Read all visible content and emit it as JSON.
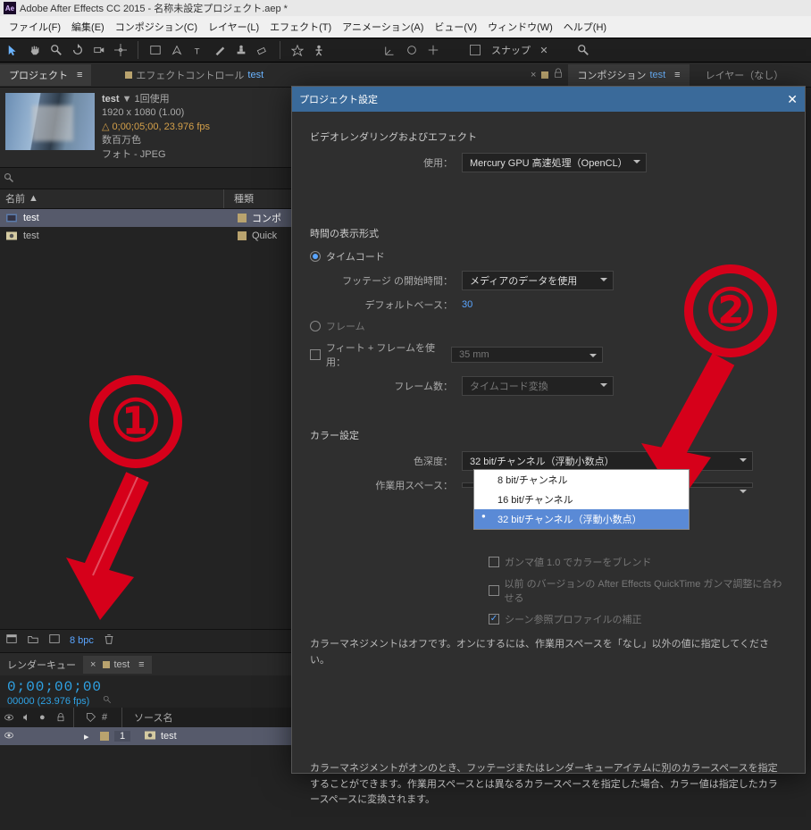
{
  "titlebar": {
    "logo_text": "Ae",
    "title": "Adobe After Effects CC 2015 - 名称未設定プロジェクト.aep *"
  },
  "menu": {
    "file": "ファイル(F)",
    "edit": "編集(E)",
    "composition": "コンポジション(C)",
    "layer": "レイヤー(L)",
    "effect": "エフェクト(T)",
    "animation": "アニメーション(A)",
    "view": "ビュー(V)",
    "window": "ウィンドウ(W)",
    "help": "ヘルプ(H)"
  },
  "toolbar": {
    "snap": "スナップ"
  },
  "panel": {
    "project": "プロジェクト",
    "effect_controls_prefix": "エフェクトコントロール ",
    "effect_controls_target": "test",
    "comp_prefix": "コンポジション ",
    "comp_target": "test",
    "layer_none": "レイヤー（なし）"
  },
  "footage": {
    "name": "test",
    "uses_suffix": " ▼ 1回使用",
    "dims": "1920 x 1080 (1.00)",
    "duration": "△ 0;00;05;00, 23.976 fps",
    "colors": "数百万色",
    "format": "フォト - JPEG"
  },
  "project_list": {
    "col_name": "名前",
    "col_type": "種類",
    "rows": [
      {
        "name": "test",
        "type": "コンポ"
      },
      {
        "name": "test",
        "type": "Quick"
      }
    ]
  },
  "proj_bottom": {
    "bpc": "8 bpc"
  },
  "timeline": {
    "tabs": {
      "render_queue": "レンダーキュー",
      "comp": "test"
    },
    "timecode": "0;00;00;00",
    "frames_fps": "00000 (23.976 fps)",
    "head": {
      "num": "#",
      "source_name": "ソース名"
    },
    "layers": [
      {
        "num": "1",
        "name": "test"
      }
    ]
  },
  "dialog": {
    "title": "プロジェクト設定",
    "sec_render": "ビデオレンダリングおよびエフェクト",
    "use_label": "使用：",
    "use_value": "Mercury GPU 高速処理（OpenCL）",
    "sec_time": "時間の表示形式",
    "radio_timecode": "タイムコード",
    "footage_start_label": "フッテージ の開始時間：",
    "footage_start_value": "メディアのデータを使用",
    "default_base_label": "デフォルトベース：",
    "default_base_value": "30",
    "radio_frames": "フレーム",
    "feet_frames_label": "フィート + フレームを使用：",
    "feet_frames_value": "35 mm",
    "frame_count_label": "フレーム数：",
    "frame_count_value": "タイムコード変換",
    "sec_color": "カラー設定",
    "depth_label": "色深度：",
    "depth_value": "32 bit/チャンネル（浮動小数点）",
    "workspace_label": "作業用スペース：",
    "gamma_blend": "ガンマ値 1.0 でカラーをブレンド",
    "legacy_qt": "以前 のバージョンの After Effects QuickTime ガンマ調整に合わせる",
    "scene_ref": "シーン参照プロファイルの補正",
    "cm_off": "カラーマネジメントはオフです。オンにするには、作業用スペースを「なし」以外の値に指定してください。",
    "cm_on_desc": "カラーマネジメントがオンのとき、フッテージまたはレンダーキューアイテムに別のカラースペースを指定することができます。作業用スペースとは異なるカラースペースを指定した場合、カラー値は指定したカラースペースに変換されます。",
    "depth_options": [
      "8 bit/チャンネル",
      "16 bit/チャンネル",
      "32 bit/チャンネル（浮動小数点）"
    ]
  },
  "callouts": {
    "one": "①",
    "two": "②"
  }
}
